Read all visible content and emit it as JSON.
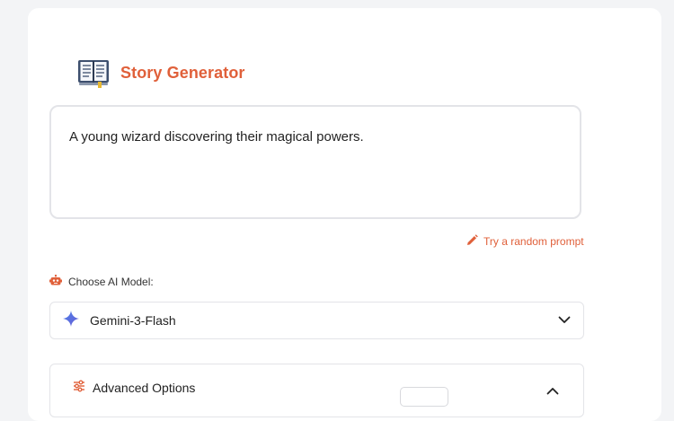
{
  "header": {
    "title": "Story Generator",
    "icon": "book-icon"
  },
  "prompt": {
    "value": "A young wizard discovering their magical powers."
  },
  "random_prompt": {
    "label": "Try a random prompt",
    "icon": "pencil-icon"
  },
  "model": {
    "label": "Choose AI Model:",
    "label_icon": "robot-icon",
    "selected": "Gemini-3-Flash",
    "selected_icon": "sparkle-icon"
  },
  "advanced": {
    "label": "Advanced Options",
    "icon": "sliders-icon",
    "expanded": true
  },
  "colors": {
    "accent": "#e0603a",
    "background": "#f3f4f6",
    "card": "#ffffff",
    "border": "#e3e4e8"
  }
}
